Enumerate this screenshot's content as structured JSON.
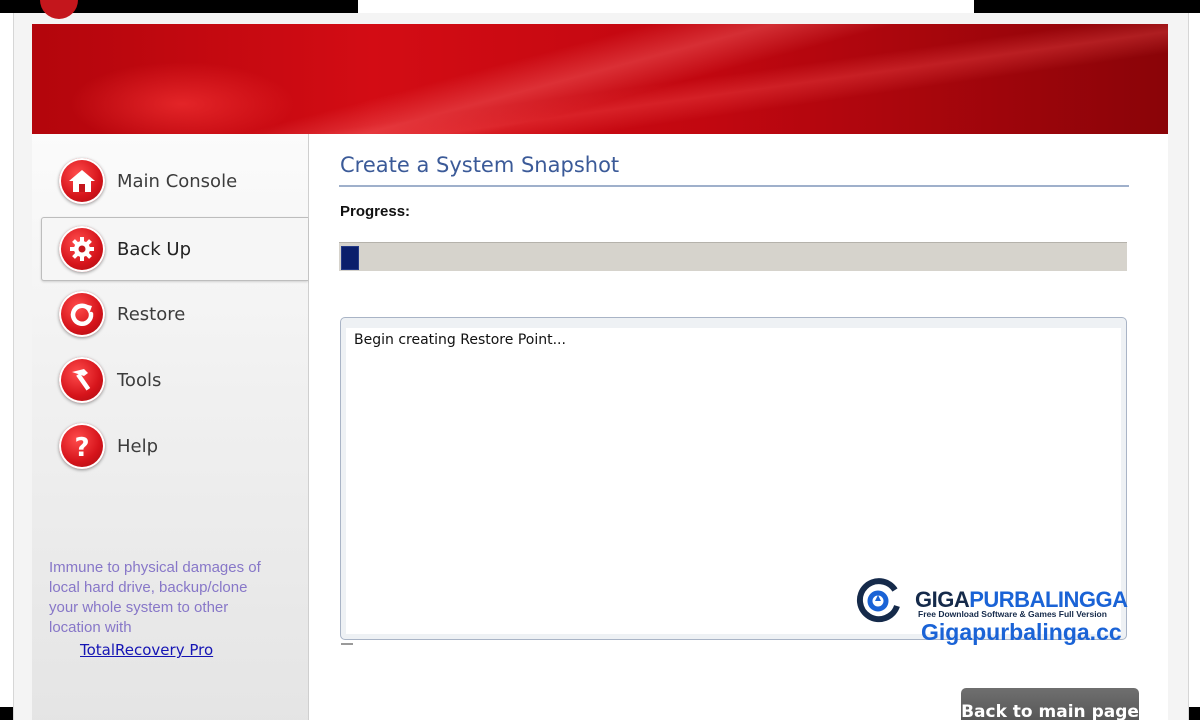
{
  "sidebar": {
    "items": [
      {
        "label": "Main Console",
        "icon": "home-icon"
      },
      {
        "label": "Back Up",
        "icon": "gear-icon"
      },
      {
        "label": "Restore",
        "icon": "restore-arrow-icon"
      },
      {
        "label": "Tools",
        "icon": "hammer-icon"
      },
      {
        "label": "Help",
        "icon": "question-icon"
      }
    ],
    "active_item": "Back Up",
    "promo_text": "Immune to physical damages of local hard drive, backup/clone your whole system to other location with",
    "promo_link": "TotalRecovery Pro"
  },
  "main": {
    "title": "Create a System Snapshot",
    "progress_label": "Progress:",
    "progress_percent": 2,
    "log_text": "Begin creating Restore Point...",
    "back_button": "Back to main page"
  },
  "watermark": {
    "name_part1": "GIGA",
    "name_part2": "PURBALINGGA",
    "tagline": "Free Download Software & Games Full Version",
    "url": "Gigapurbalinga.cc"
  },
  "colors": {
    "banner_red": "#c10710",
    "title_blue": "#3b5a98",
    "progress_fill": "#0b1f6b",
    "promo_text": "#8777c8",
    "link": "#1414b4"
  }
}
